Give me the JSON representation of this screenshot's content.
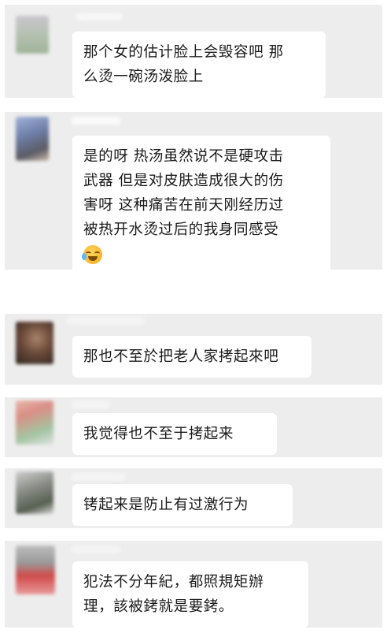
{
  "comments": [
    {
      "text": "那个女的估计脸上会毁容吧 那\n么烫一碗汤泼脸上"
    },
    {
      "text": "是的呀 热汤虽然说不是硬攻击\n武器 但是对皮肤造成很大的伤\n害呀 这种痛苦在前天刚经历过\n被热开水烫过后的我身同感受",
      "emoji": "laugh-cry-emoji"
    },
    {
      "text": "那也不至於把老人家拷起來吧"
    },
    {
      "text": "我觉得也不至于拷起来"
    },
    {
      "text": "铐起来是防止有过激行为"
    },
    {
      "text": "犯法不分年紀，都照規矩辦\n理，該被銬就是要銬。"
    }
  ]
}
